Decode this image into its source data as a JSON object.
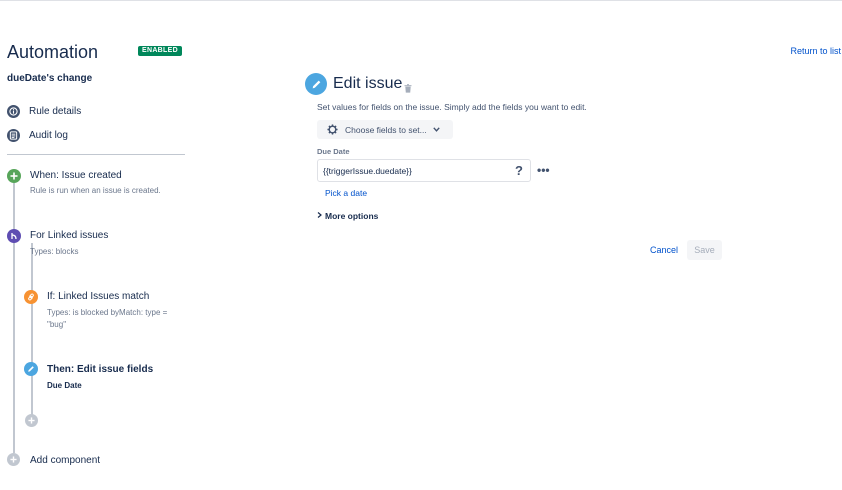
{
  "header": {
    "title": "Automation",
    "badge": "ENABLED",
    "return_link": "Return to list",
    "rule_name": "dueDate's change"
  },
  "sidebar": {
    "nav": [
      {
        "label": "Rule details",
        "icon": "info-icon"
      },
      {
        "label": "Audit log",
        "icon": "log-icon"
      }
    ],
    "steps": {
      "trigger": {
        "title": "When: Issue created",
        "subtitle": "Rule is run when an issue is created.",
        "icon": "plus-icon",
        "color": "#57a55a"
      },
      "branch": {
        "title": "For Linked issues",
        "subtitle": "Types: blocks",
        "icon": "branch-icon",
        "color": "#5e4db2"
      },
      "condition": {
        "title": "If: Linked Issues match",
        "subtitle_line1": "Types: is blocked byMatch: type =",
        "subtitle_line2": "\"bug\"",
        "icon": "link-icon",
        "color": "#f79232"
      },
      "action": {
        "title": "Then: Edit issue fields",
        "subtitle": "Due Date",
        "icon": "pencil-icon",
        "color": "#4ca6e0"
      }
    },
    "add_component": "Add component"
  },
  "main": {
    "title": "Edit issue",
    "description": "Set values for fields on the issue. Simply add the fields you want to edit.",
    "choose_fields": "Choose fields to set...",
    "due_date_label": "Due Date",
    "due_date_value": "{{triggerIssue.duedate}}",
    "help": "?",
    "more": "•••",
    "pick_date": "Pick a date",
    "more_options": "More options",
    "cancel": "Cancel",
    "save": "Save"
  },
  "colors": {
    "link": "#0052cc",
    "enabled": "#00875a",
    "text": "#172b4d"
  }
}
